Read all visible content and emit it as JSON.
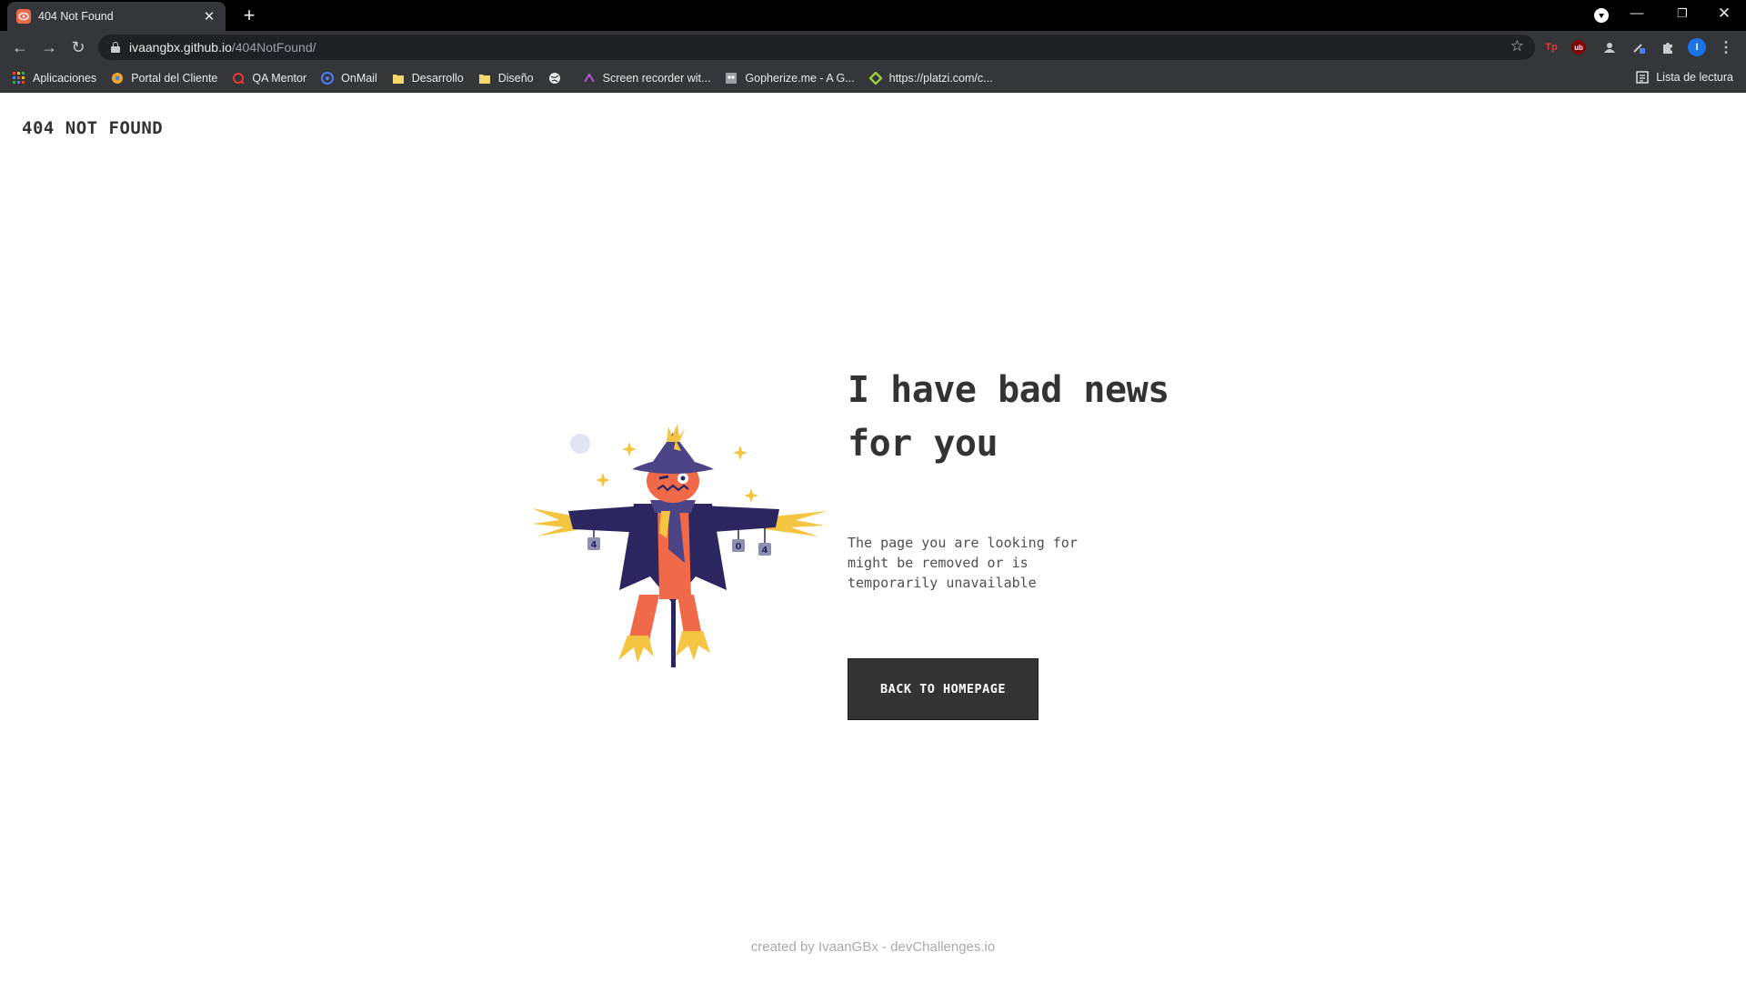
{
  "browser": {
    "tab": {
      "title": "404 Not Found"
    },
    "address": {
      "host": "ivaangbx.github.io",
      "path": "/404NotFound/"
    },
    "bookmarks": [
      {
        "label": "Aplicaciones",
        "icon": "apps-grid-icon",
        "color": "#ea4335"
      },
      {
        "label": "Portal del Cliente",
        "icon": "portal-icon",
        "color": "#f4a522"
      },
      {
        "label": "QA Mentor",
        "icon": "qa-mentor-icon",
        "color": "#e53935"
      },
      {
        "label": "OnMail",
        "icon": "onmail-icon",
        "color": "#4f7df5"
      },
      {
        "label": "Desarrollo",
        "icon": "folder-icon",
        "color": "#f5d76e"
      },
      {
        "label": "Diseño",
        "icon": "folder-icon",
        "color": "#f5d76e"
      },
      {
        "label": "",
        "icon": "globe-icon",
        "color": "#e8eaed"
      },
      {
        "label": "Screen recorder wit...",
        "icon": "screen-recorder-icon",
        "color": "#b455d8"
      },
      {
        "label": "Gopherize.me - A G...",
        "icon": "gopherize-icon",
        "color": "#9aa0a6"
      },
      {
        "label": "https://platzi.com/c...",
        "icon": "platzi-icon",
        "color": "#98ca3f"
      }
    ],
    "reading_list": "Lista de lectura",
    "extensions": [
      {
        "label": "Tp",
        "color": "#e53935"
      },
      {
        "label": "ub",
        "color": "#800000"
      },
      {
        "label": "",
        "color": "#c9cacd"
      },
      {
        "label": "",
        "color": "#c9cacd"
      }
    ],
    "profile_initial": "I"
  },
  "page": {
    "brand": "404 NOT FOUND",
    "headline": [
      "I have bad news",
      "for you"
    ],
    "description": [
      "The page you are looking for",
      "might be removed or is",
      "temporarily unavailable"
    ],
    "cta": "BACK TO HOMEPAGE",
    "footer": "created by IvaanGBx - devChallenges.io",
    "illustration": {
      "sign_letters": [
        "4",
        "0",
        "4"
      ]
    },
    "colors": {
      "text": "#333333",
      "button": "#333333",
      "footer": "#a9a9a9",
      "accent": "#f06a4a",
      "straw": "#f5c542",
      "coat": "#2b2660"
    }
  }
}
